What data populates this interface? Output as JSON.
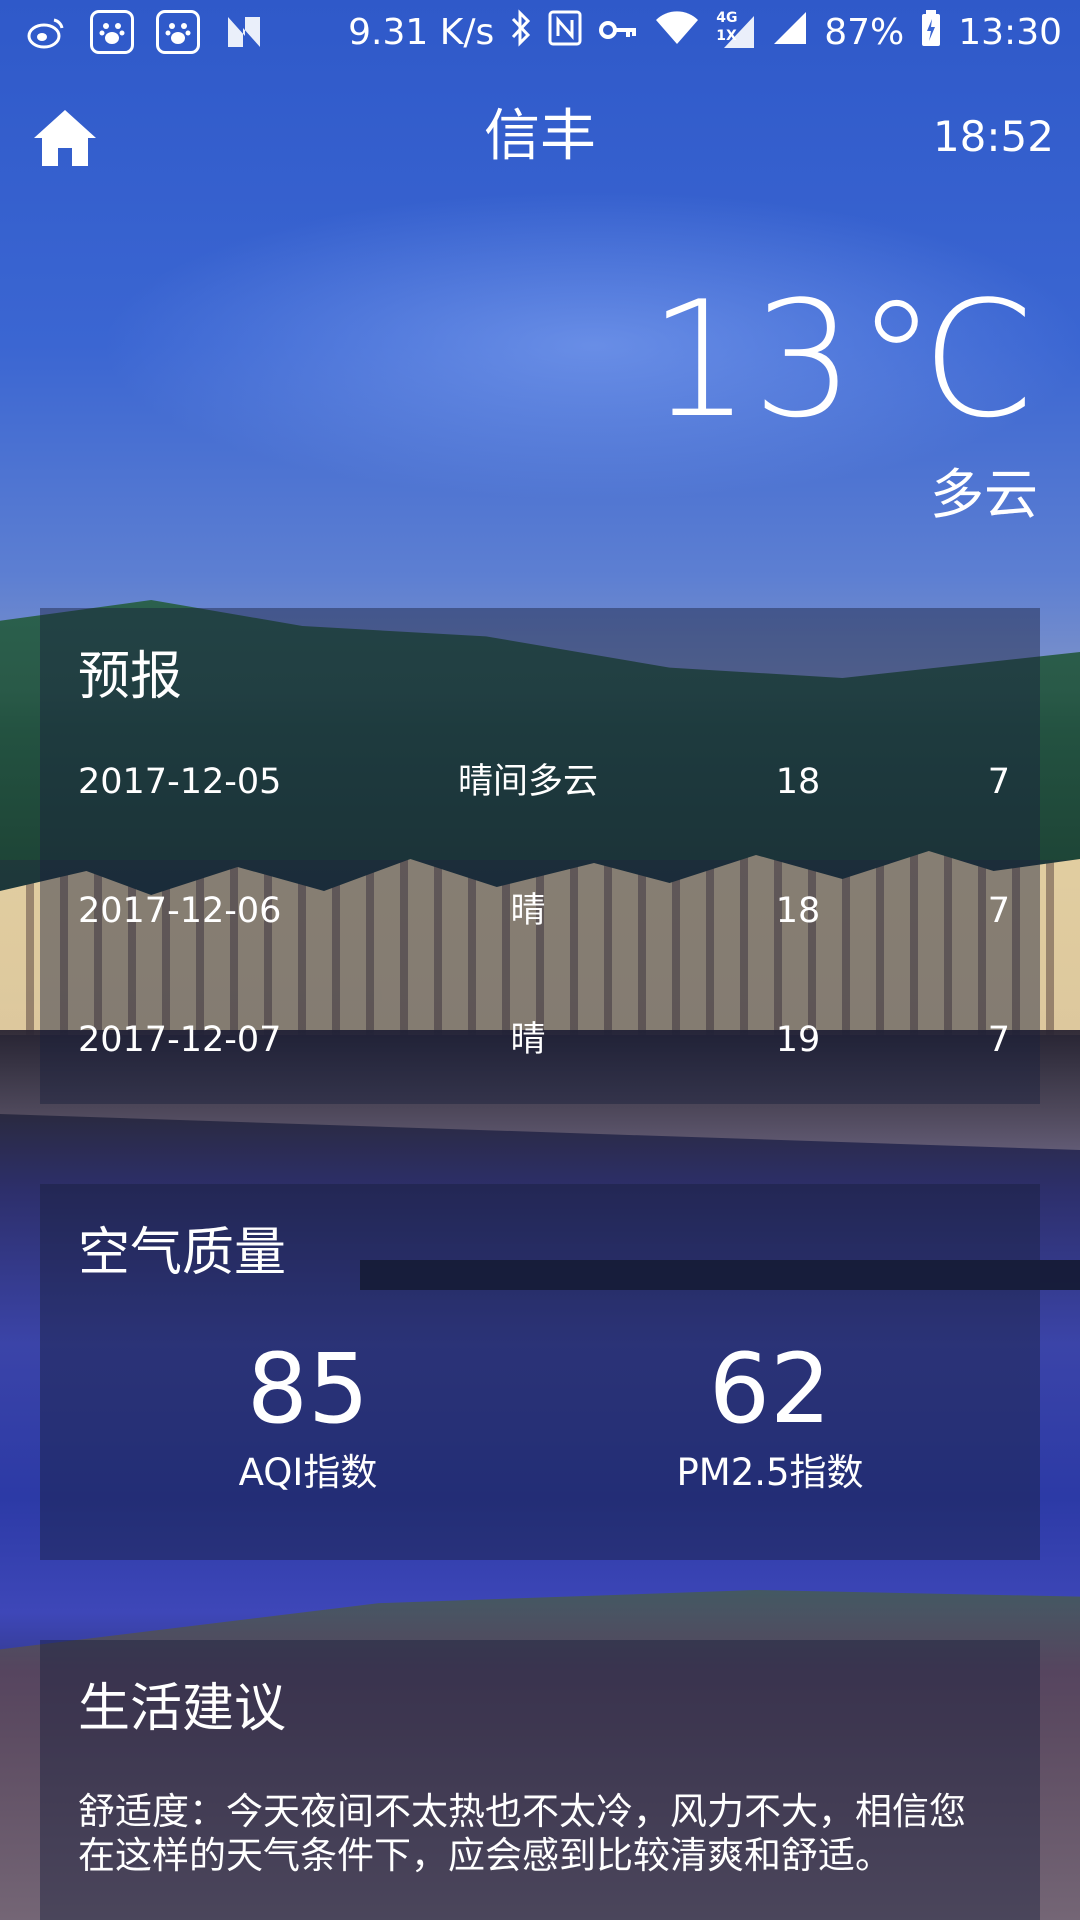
{
  "status_bar": {
    "network_speed": "9.31 K/s",
    "network_type": "4G",
    "network_sub": "1X",
    "battery": "87%",
    "clock": "13:30"
  },
  "header": {
    "city": "信丰",
    "update_time": "18:52"
  },
  "current": {
    "temperature": "13℃",
    "condition": "多云"
  },
  "forecast": {
    "title": "预报",
    "rows": [
      {
        "date": "2017-12-05",
        "weather": "晴间多云",
        "max": "18",
        "min": "7"
      },
      {
        "date": "2017-12-06",
        "weather": "晴",
        "max": "18",
        "min": "7"
      },
      {
        "date": "2017-12-07",
        "weather": "晴",
        "max": "19",
        "min": "7"
      }
    ]
  },
  "aqi": {
    "title": "空气质量",
    "aqi_value": "85",
    "aqi_label": "AQI指数",
    "pm25_value": "62",
    "pm25_label": "PM2.5指数"
  },
  "suggestion": {
    "title": "生活建议",
    "comfort": "舒适度：今天夜间不太热也不太冷，风力不大，相信您在这样的天气条件下，应会感到比较清爽和舒适。"
  },
  "colors": {
    "card_background": "#191E3C",
    "text": "#FFFFFF",
    "sky": "#3B66D2"
  },
  "icons": {
    "home": "home-icon",
    "weibo": "weibo-icon",
    "baidu": "baidu-paw-icon",
    "nfc_n": "n-logo-icon",
    "bluetooth": "bluetooth-icon",
    "nfc": "nfc-icon",
    "key": "key-icon",
    "wifi": "wifi-icon",
    "signal": "signal-icon",
    "battery": "battery-icon"
  }
}
